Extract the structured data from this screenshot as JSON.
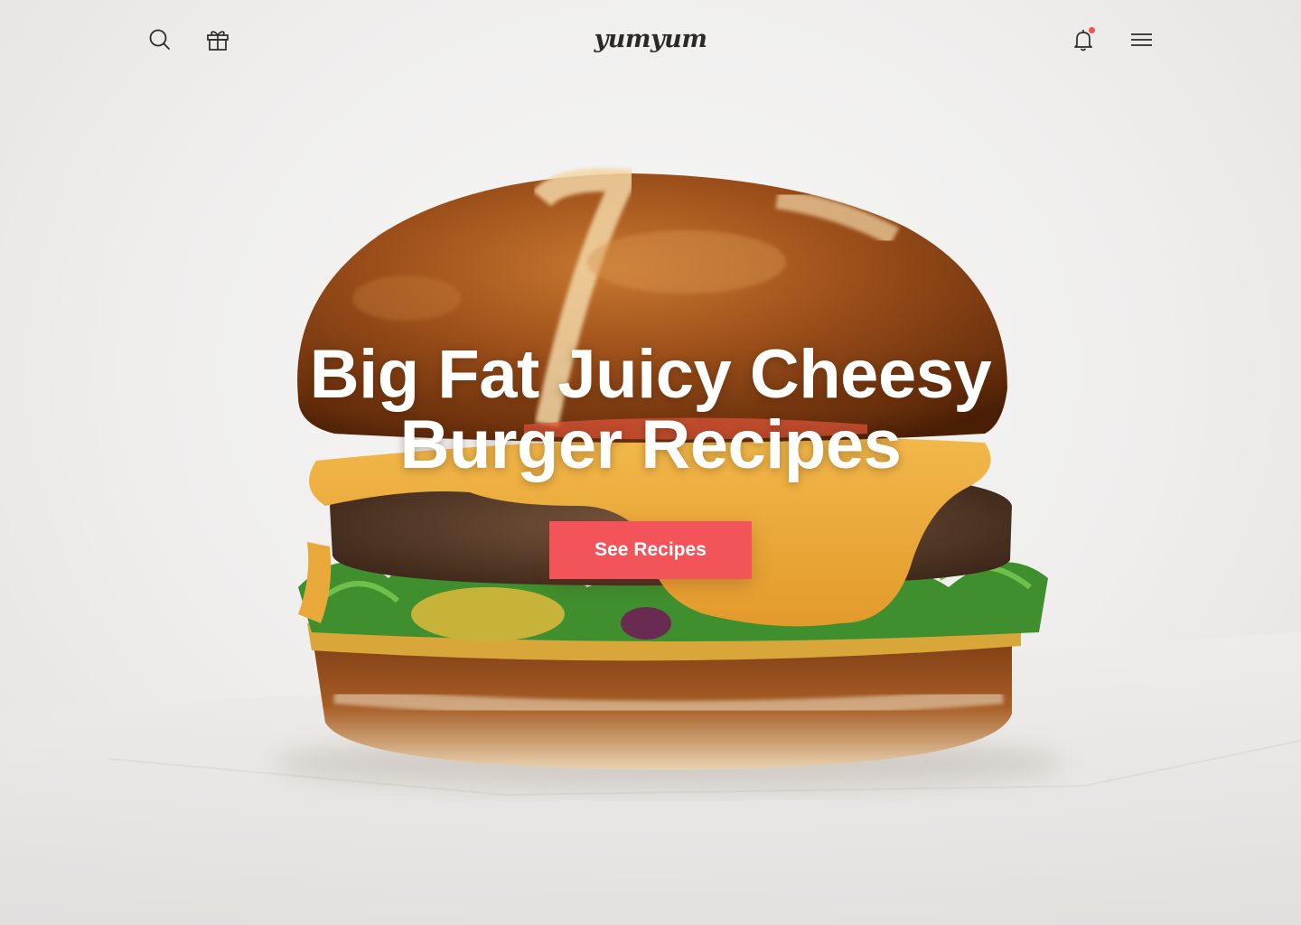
{
  "header": {
    "logo_text": "yumyum",
    "icons": {
      "search": "search-icon",
      "gift": "gift-icon",
      "notifications": "bell-icon",
      "menu": "hamburger-menu-icon"
    },
    "has_notification": true
  },
  "hero": {
    "headline_line1": "Big Fat Juicy Cheesy",
    "headline_line2": "Burger Recipes",
    "cta_label": "See Recipes"
  },
  "colors": {
    "accent": "#f3545a",
    "notification_dot": "#f0534f",
    "text_dark": "#2a2a2a",
    "headline": "#ffffff"
  }
}
